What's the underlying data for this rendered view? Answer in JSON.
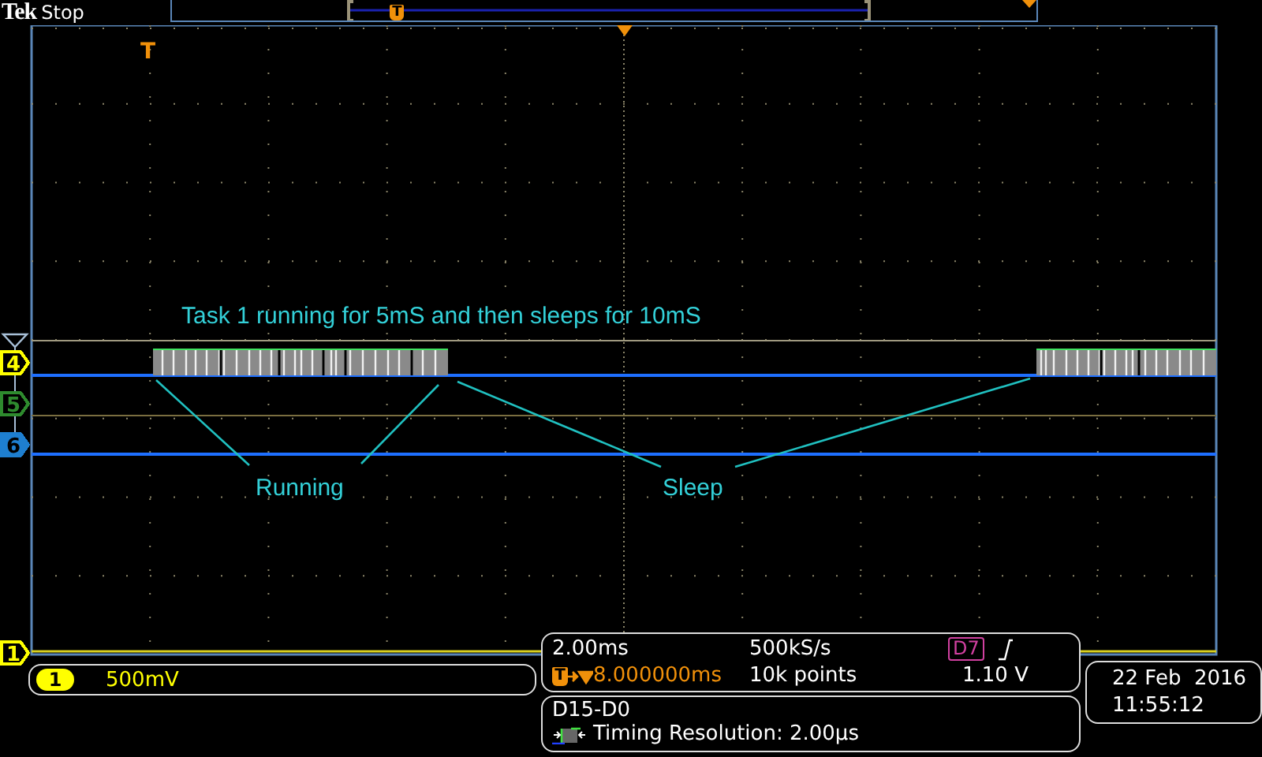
{
  "header": {
    "brand": "Tek",
    "state": "Stop"
  },
  "record_view": {
    "trigger_marker": "T"
  },
  "waveform": {
    "trigger_marker": "T",
    "annotation": "Task 1 running for 5mS and then sleeps for 10mS",
    "labels": [
      {
        "text": "Running"
      },
      {
        "text": "Sleep"
      }
    ],
    "channels": [
      {
        "label": "4",
        "color": "#ffff00"
      },
      {
        "label": "5",
        "color": "#2e8b2e"
      },
      {
        "label": "6",
        "color": "#1e7fd0"
      },
      {
        "label": "1",
        "color": "#ffff00"
      }
    ]
  },
  "channel_readout": {
    "channel": "1",
    "scale": "500mV"
  },
  "timebase": {
    "scale": "2.00ms",
    "sample_rate": "500kS/s",
    "trigger_source": "D7",
    "trigger_marker": "T",
    "trigger_position": "8.000000ms",
    "record_length": "10k points",
    "trigger_level": "1.10 V"
  },
  "bus": {
    "name": "D15-D0",
    "detail": "Timing Resolution: 2.00µs"
  },
  "datetime": {
    "date": "22 Feb  2016",
    "time": "11:55:12"
  }
}
